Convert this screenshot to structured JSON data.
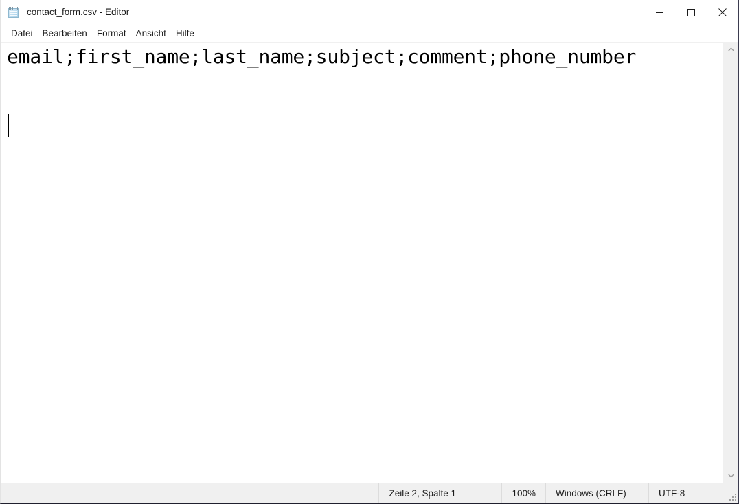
{
  "window": {
    "title": "contact_form.csv - Editor",
    "icon": "notepad-icon",
    "controls": {
      "minimize": "minimize-icon",
      "maximize": "maximize-icon",
      "close": "close-icon"
    }
  },
  "menubar": {
    "items": [
      {
        "label": "Datei"
      },
      {
        "label": "Bearbeiten"
      },
      {
        "label": "Format"
      },
      {
        "label": "Ansicht"
      },
      {
        "label": "Hilfe"
      }
    ]
  },
  "editor": {
    "content": "email;first_name;last_name;subject;comment;phone_number",
    "caret_line": 2,
    "caret_column": 1
  },
  "scrollbar": {
    "up_arrow": "chevron-up-icon",
    "down_arrow": "chevron-down-icon"
  },
  "statusbar": {
    "position": "Zeile 2, Spalte 1",
    "zoom": "100%",
    "line_ending": "Windows (CRLF)",
    "encoding": "UTF-8"
  },
  "colors": {
    "chrome": "#ffffff",
    "statusbar_bg": "#f0f0f0",
    "scrollbar_bg": "#f0f0f0",
    "text": "#000000",
    "close_hover": "#e81123"
  }
}
